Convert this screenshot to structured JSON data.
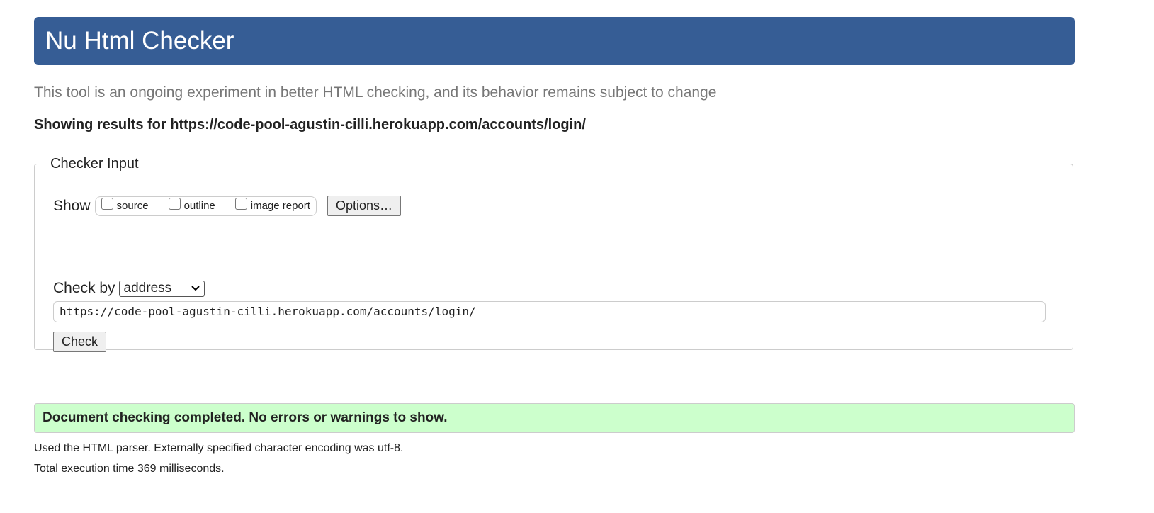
{
  "header": {
    "title": "Nu Html Checker"
  },
  "intro": "This tool is an ongoing experiment in better HTML checking, and its behavior remains subject to change",
  "showing": "Showing results for https://code-pool-agustin-cilli.herokuapp.com/accounts/login/",
  "checker_input": {
    "legend": "Checker Input",
    "show_label": "Show",
    "options": [
      {
        "label": "source",
        "checked": false
      },
      {
        "label": "outline",
        "checked": false
      },
      {
        "label": "image report",
        "checked": false
      }
    ],
    "options_button": "Options…",
    "check_by_label": "Check by",
    "check_by_value": "address",
    "url_value": "https://code-pool-agustin-cilli.herokuapp.com/accounts/login/",
    "check_button": "Check"
  },
  "results": {
    "success": "Document checking completed. No errors or warnings to show.",
    "parser_info": "Used the HTML parser. Externally specified character encoding was utf-8.",
    "timing": "Total execution time 369 milliseconds."
  },
  "colors": {
    "header": "#365d95",
    "success_bg": "#ccffcc"
  }
}
